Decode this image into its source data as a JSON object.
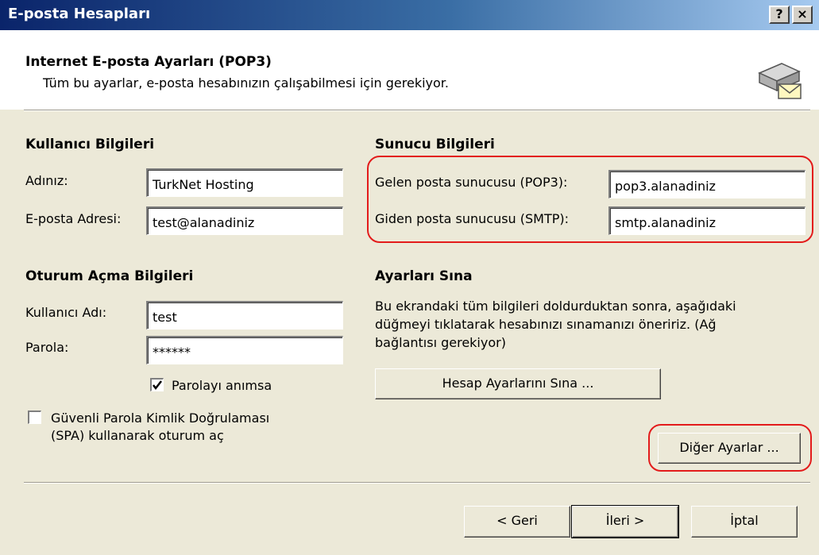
{
  "window": {
    "title": "E-posta Hesapları",
    "help_button": "?",
    "close_button": "×"
  },
  "header": {
    "title": "Internet E-posta Ayarları (POP3)",
    "subtitle": "Tüm bu ayarlar, e-posta hesabınızın çalışabilmesi için gerekiyor.",
    "icon": "mail-server-icon"
  },
  "user_info": {
    "heading": "Kullanıcı Bilgileri",
    "name_label": "Adınız:",
    "name_value": "TurkNet Hosting",
    "email_label": "E-posta Adresi:",
    "email_value": "test@alanadiniz"
  },
  "server_info": {
    "heading": "Sunucu Bilgileri",
    "incoming_label": "Gelen posta sunucusu (POP3):",
    "incoming_value": "pop3.alanadiniz",
    "outgoing_label": "Giden posta sunucusu (SMTP):",
    "outgoing_value": "smtp.alanadiniz"
  },
  "logon_info": {
    "heading": "Oturum Açma Bilgileri",
    "username_label": "Kullanıcı Adı:",
    "username_value": "test",
    "password_label": "Parola:",
    "password_value": "******",
    "remember_label": "Parolayı anımsa",
    "remember_checked": true,
    "spa_label_line1": "Güvenli Parola Kimlik Doğrulaması",
    "spa_label_line2": "(SPA) kullanarak oturum aç",
    "spa_checked": false
  },
  "test_settings": {
    "heading": "Ayarları Sına",
    "description_line1": "Bu ekrandaki tüm bilgileri doldurduktan sonra, aşağıdaki",
    "description_line2": "düğmeyi tıklatarak hesabınızı sınamanızı öneririz. (Ağ",
    "description_line3": "bağlantısı gerekiyor)",
    "test_button": "Hesap Ayarlarını Sına ..."
  },
  "more_settings_button": "Diğer Ayarlar ...",
  "nav": {
    "back": "< Geri",
    "next": "İleri >",
    "cancel": "İptal"
  },
  "highlight_color": "#e31b1b"
}
